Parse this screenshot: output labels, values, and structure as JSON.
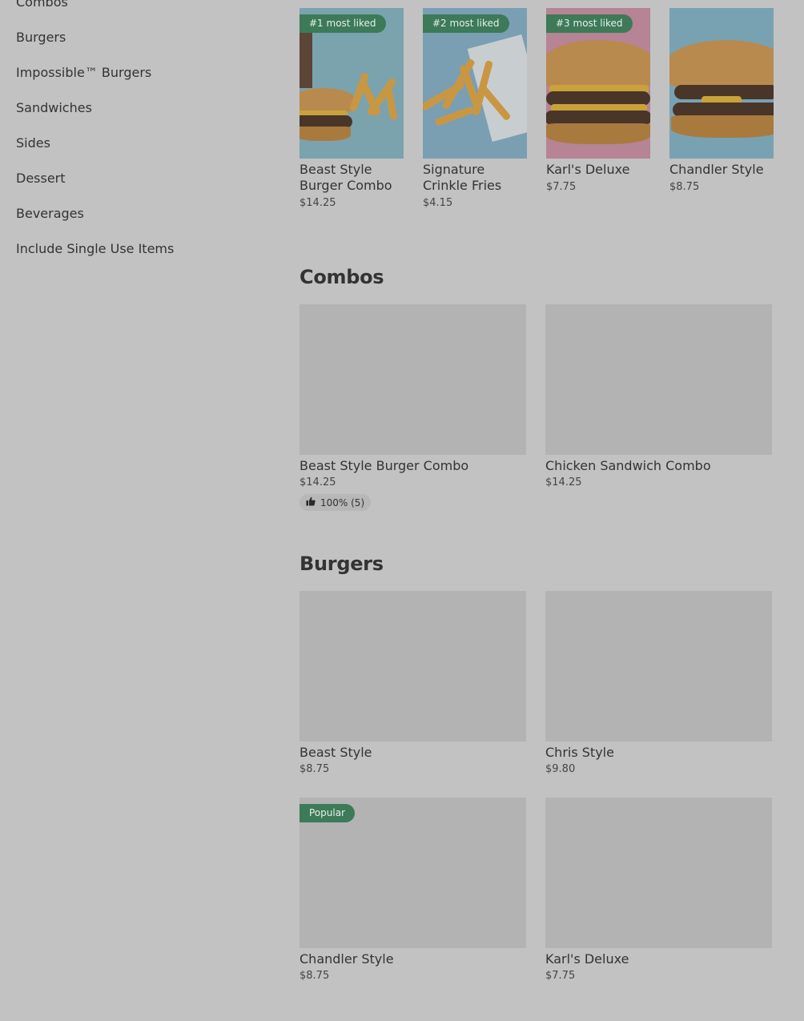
{
  "sidebar": {
    "items": [
      {
        "label": "Combos"
      },
      {
        "label": "Burgers"
      },
      {
        "label": "Impossible™ Burgers"
      },
      {
        "label": "Sandwiches"
      },
      {
        "label": "Sides"
      },
      {
        "label": "Dessert"
      },
      {
        "label": "Beverages"
      },
      {
        "label": "Include Single Use Items"
      }
    ]
  },
  "featured": [
    {
      "badge": "#1 most liked",
      "name": "Beast Style Burger Combo",
      "price": "$14.25"
    },
    {
      "badge": "#2 most liked",
      "name": "Signature Crinkle Fries",
      "price": "$4.15"
    },
    {
      "badge": "#3 most liked",
      "name": "Karl's Deluxe",
      "price": "$7.75"
    },
    {
      "badge": "",
      "name": "Chandler Style",
      "price": "$8.75"
    }
  ],
  "combos": {
    "title": "Combos",
    "items": [
      {
        "name": "Beast Style Burger Combo",
        "price": "$14.25",
        "rating": "100% (5)"
      },
      {
        "name": "Chicken Sandwich Combo",
        "price": "$14.25"
      }
    ]
  },
  "burgers": {
    "title": "Burgers",
    "items": [
      {
        "name": "Beast Style",
        "price": "$8.75"
      },
      {
        "name": "Chris Style",
        "price": "$9.80"
      },
      {
        "name": "Chandler Style",
        "price": "$8.75",
        "badge": "Popular"
      },
      {
        "name": "Karl's Deluxe",
        "price": "$7.75"
      }
    ]
  },
  "colors": {
    "badge_bg": "#3c7a58",
    "overlay_bg": "#c2c2c2"
  },
  "icons": {
    "rating": "thumbs-up-icon"
  }
}
